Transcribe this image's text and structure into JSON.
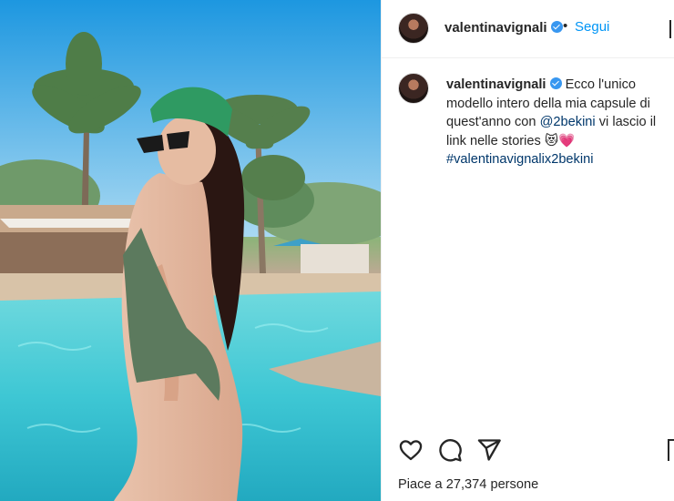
{
  "post": {
    "username": "valentinavignali",
    "verified": true,
    "separator": "•",
    "follow_label": "Segui",
    "caption": {
      "username": "valentinavignali",
      "text_before_mention": "Ecco l'unico modello intero della mia capsule di quest'anno con",
      "mention": "@2bekini",
      "text_after_mention": "vi lascio il link nelle stories",
      "emojis": "😻💗",
      "hashtag": "#valentinavignalix2bekini"
    },
    "likes": {
      "prefix": "Piace a",
      "count": "27,374",
      "suffix": "persone"
    }
  },
  "icons": {
    "like": "heart-icon",
    "comment": "comment-bubble-icon",
    "share": "paper-plane-icon",
    "save": "bookmark-icon",
    "verified": "verified-badge-icon",
    "more": "more-options-icon"
  },
  "colors": {
    "link_blue": "#0095f6",
    "mention_blue": "#00376b",
    "verified_blue": "#3897f0",
    "text": "#262626",
    "divider": "#efefef"
  }
}
